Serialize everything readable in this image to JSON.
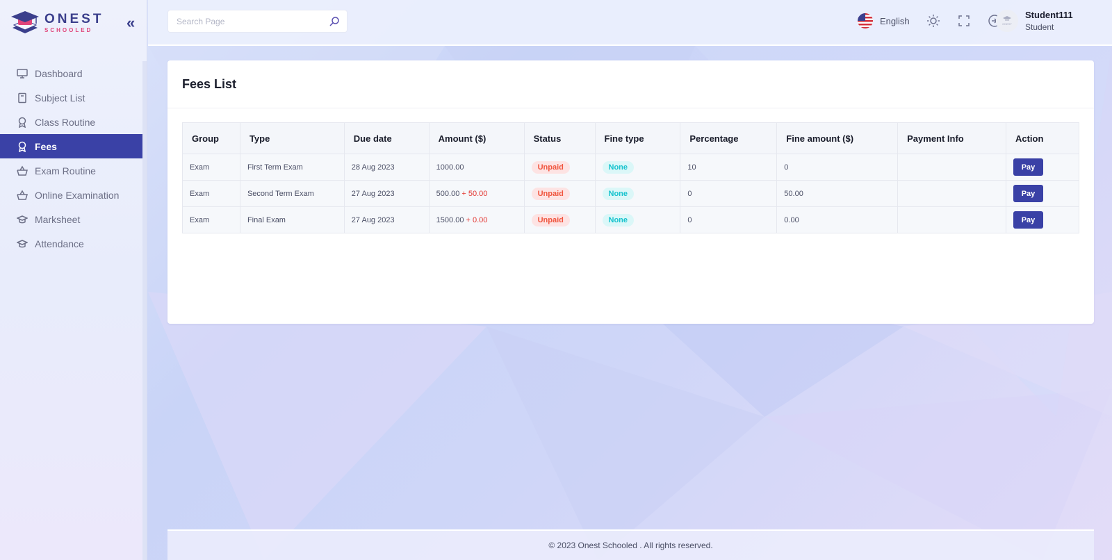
{
  "brand": {
    "name": "ONEST",
    "sub": "SCHOOLED"
  },
  "sidebar": {
    "items": [
      {
        "label": "Dashboard",
        "icon": "monitor-icon",
        "active": false
      },
      {
        "label": "Subject List",
        "icon": "book-icon",
        "active": false
      },
      {
        "label": "Class Routine",
        "icon": "award-icon",
        "active": false
      },
      {
        "label": "Fees",
        "icon": "award-icon",
        "active": true
      },
      {
        "label": "Exam Routine",
        "icon": "basket-icon",
        "active": false
      },
      {
        "label": "Online Examination",
        "icon": "basket-icon",
        "active": false
      },
      {
        "label": "Marksheet",
        "icon": "graduation-cap-icon",
        "active": false
      },
      {
        "label": "Attendance",
        "icon": "graduation-cap-icon",
        "active": false
      }
    ]
  },
  "topbar": {
    "search_placeholder": "Search Page",
    "language": "English",
    "user_name": "Student111",
    "user_role": "Student",
    "avatar_text": "ONEST"
  },
  "page": {
    "title": "Fees List"
  },
  "table": {
    "headers": [
      "Group",
      "Type",
      "Due date",
      "Amount ($)",
      "Status",
      "Fine type",
      "Percentage",
      "Fine amount ($)",
      "Payment Info",
      "Action"
    ],
    "rows": [
      {
        "group": "Exam",
        "type": "First Term Exam",
        "due_date": "28 Aug 2023",
        "amount": "1000.00",
        "fine_add": "",
        "status": "Unpaid",
        "fine_type": "None",
        "percentage": "10",
        "fine_amount": "0",
        "payment_info": "",
        "action": "Pay"
      },
      {
        "group": "Exam",
        "type": "Second Term Exam",
        "due_date": "27 Aug 2023",
        "amount": "500.00",
        "fine_add": "+ 50.00",
        "status": "Unpaid",
        "fine_type": "None",
        "percentage": "0",
        "fine_amount": "50.00",
        "payment_info": "",
        "action": "Pay"
      },
      {
        "group": "Exam",
        "type": "Final Exam",
        "due_date": "27 Aug 2023",
        "amount": "1500.00",
        "fine_add": "+ 0.00",
        "status": "Unpaid",
        "fine_type": "None",
        "percentage": "0",
        "fine_amount": "0.00",
        "payment_info": "",
        "action": "Pay"
      }
    ]
  },
  "footer": {
    "text": "© 2023 Onest Schooled . All rights reserved."
  },
  "colors": {
    "primary": "#3a41a6",
    "unpaid": "#f0553e",
    "none_badge": "#17c3ce",
    "fine": "#e3342f"
  }
}
